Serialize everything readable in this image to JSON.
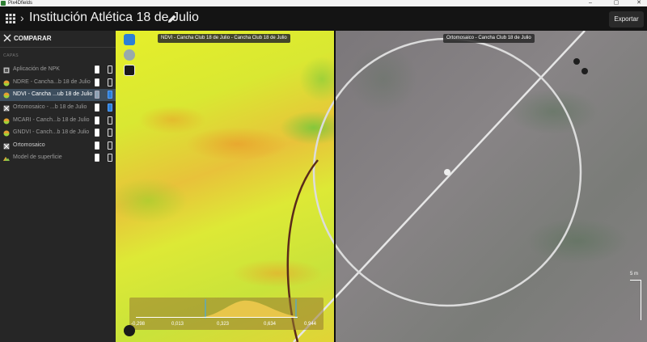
{
  "window": {
    "title": "Pix4Dfields",
    "controls": [
      "–",
      "▢",
      "✕"
    ]
  },
  "header": {
    "project_title": "Institución Atlética 18 de Julio",
    "export_label": "Exportar"
  },
  "sidebar": {
    "compare_label": "COMPARAR",
    "layers_heading": "CAPAS",
    "layers": [
      {
        "label": "Aplicación de NPK",
        "icon": "npk-icon",
        "selected": false
      },
      {
        "label": "NDRE - Cancha...b 18 de Julio",
        "icon": "index-icon",
        "selected": false
      },
      {
        "label": "NDVI - Cancha ...ub 18 de Julio",
        "icon": "index-icon",
        "selected": true
      },
      {
        "label": "Ortomosaico - ...b 18 de Julio",
        "icon": "orthomosaic-icon",
        "selected": false
      },
      {
        "label": "MCARI - Canch...b 18 de Julio",
        "icon": "index-icon",
        "selected": false
      },
      {
        "label": "GNDVI - Canch...b 18 de Julio",
        "icon": "index-icon",
        "selected": false
      },
      {
        "label": "Ortomosaico",
        "icon": "orthomosaic-icon",
        "selected": false
      },
      {
        "label": "Model de superficie",
        "icon": "surface-model-icon",
        "selected": false
      }
    ]
  },
  "map": {
    "left_label": "NDVI - Cancha Club 18 de Julio - Cancha Club 18 de Julio",
    "right_label": "Ortomosaico - Cancha Club 18 de Julio",
    "histogram_values": [
      "-0,298",
      "0,013",
      "0,323",
      "0,634",
      "0,944"
    ],
    "scale_label": "5 m"
  }
}
